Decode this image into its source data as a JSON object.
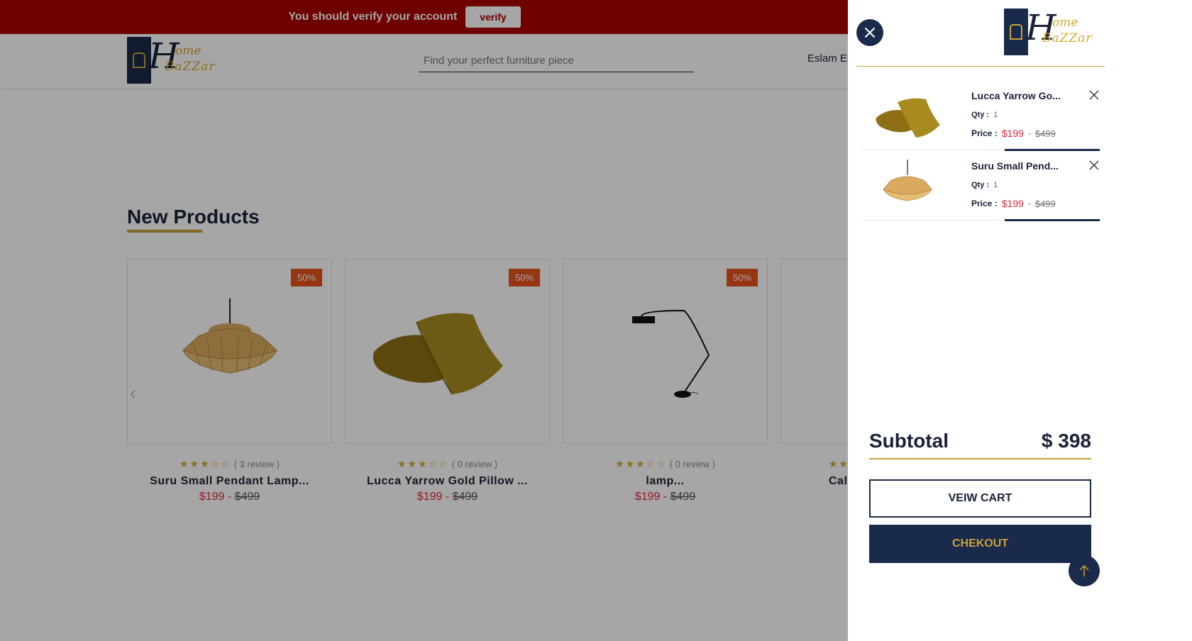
{
  "verify_bar": {
    "message": "You should verify your account",
    "button_label": "verify"
  },
  "header": {
    "logo": {
      "initial": "H",
      "ome": "ome",
      "bazar": "BaZZar"
    },
    "search_placeholder": "Find your perfect furniture piece",
    "user_name": "Eslam Elt"
  },
  "section": {
    "title": "New Products"
  },
  "products": [
    {
      "badge": "50%",
      "stars": "★★★☆☆",
      "reviews": "( 3 review )",
      "title": "Suru Small Pendant Lamp...",
      "price_new": "$199",
      "sep": " - ",
      "price_old": "$499"
    },
    {
      "badge": "50%",
      "stars": "★★★☆☆",
      "reviews": "( 0 review )",
      "title": "Lucca Yarrow Gold Pillow ...",
      "price_new": "$199",
      "sep": " - ",
      "price_old": "$499"
    },
    {
      "badge": "50%",
      "stars": "★★★☆☆",
      "reviews": "( 0 review )",
      "title": "lamp...",
      "price_new": "$199",
      "sep": " - ",
      "price_old": "$499"
    },
    {
      "badge": "",
      "stars": "★★",
      "reviews": "",
      "title": "Cal",
      "price_new": "",
      "sep": "",
      "price_old": ""
    }
  ],
  "cart": {
    "items": [
      {
        "name": "Lucca Yarrow Go...",
        "qty_label": "Qty :",
        "qty": "1",
        "price_label": "Price :",
        "price_new": "$199",
        "sep": "-",
        "price_old": "$499"
      },
      {
        "name": "Suru Small Pend...",
        "qty_label": "Qty :",
        "qty": "1",
        "price_label": "Price :",
        "price_new": "$199",
        "sep": "-",
        "price_old": "$499"
      }
    ],
    "subtotal_label": "Subtotal",
    "subtotal_value": "$ 398",
    "view_cart_label": "VEIW CART",
    "checkout_label": "CHEKOUT"
  },
  "icons": {
    "close": "close-icon",
    "remove": "remove-item-icon",
    "scroll_top": "arrow-up-icon",
    "slider_prev": "chevron-left-icon"
  },
  "colors": {
    "navy": "#1a2a4a",
    "gold": "#c9a13a",
    "verify_bar": "#a90000",
    "price_red": "#e0273b",
    "badge_orange": "#e6521c"
  }
}
